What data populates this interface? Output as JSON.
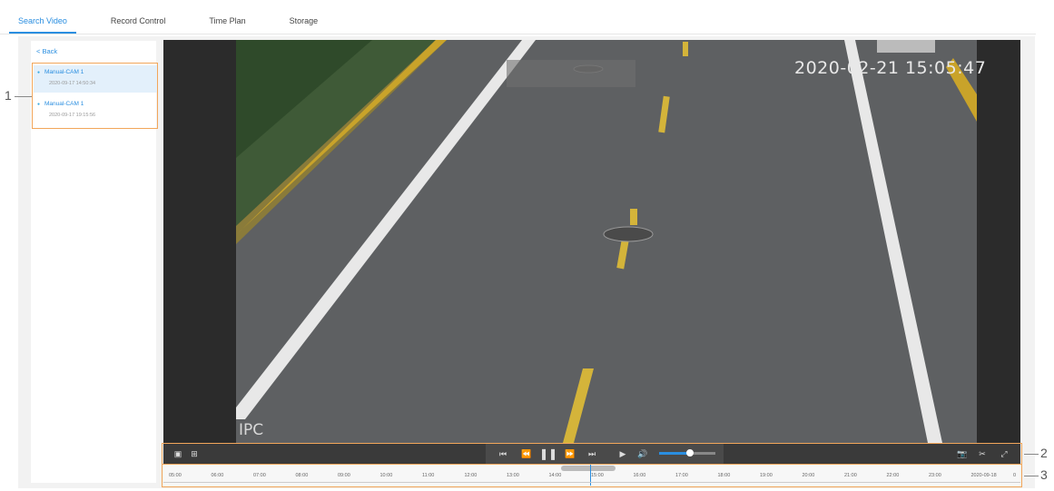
{
  "tabs": [
    {
      "label": "Search Video"
    },
    {
      "label": "Record Control"
    },
    {
      "label": "Time Plan"
    },
    {
      "label": "Storage"
    }
  ],
  "sidebar": {
    "back_label": "< Back",
    "records": [
      {
        "name": "Manual-CAM 1",
        "time": "2020-09-17 14:50:34"
      },
      {
        "name": "Manual-CAM 1",
        "time": "2020-09-17 19:15:56"
      }
    ]
  },
  "video": {
    "timestamp": "2020-02-21 15:05:47",
    "label": "IPC"
  },
  "timeline": {
    "ticks": [
      "05:00",
      "06:00",
      "07:00",
      "08:00",
      "09:00",
      "10:00",
      "11:00",
      "12:00",
      "13:00",
      "14:00",
      "15:00",
      "16:00",
      "17:00",
      "18:00",
      "19:00",
      "20:00",
      "21:00",
      "22:00",
      "23:00",
      "2020-09-18",
      "0"
    ],
    "volume_level": 0.55
  },
  "callouts": {
    "c1": "1",
    "c2": "2",
    "c3": "3"
  },
  "colors": {
    "accent": "#2a8ee0",
    "highlight": "#f2a65a"
  }
}
